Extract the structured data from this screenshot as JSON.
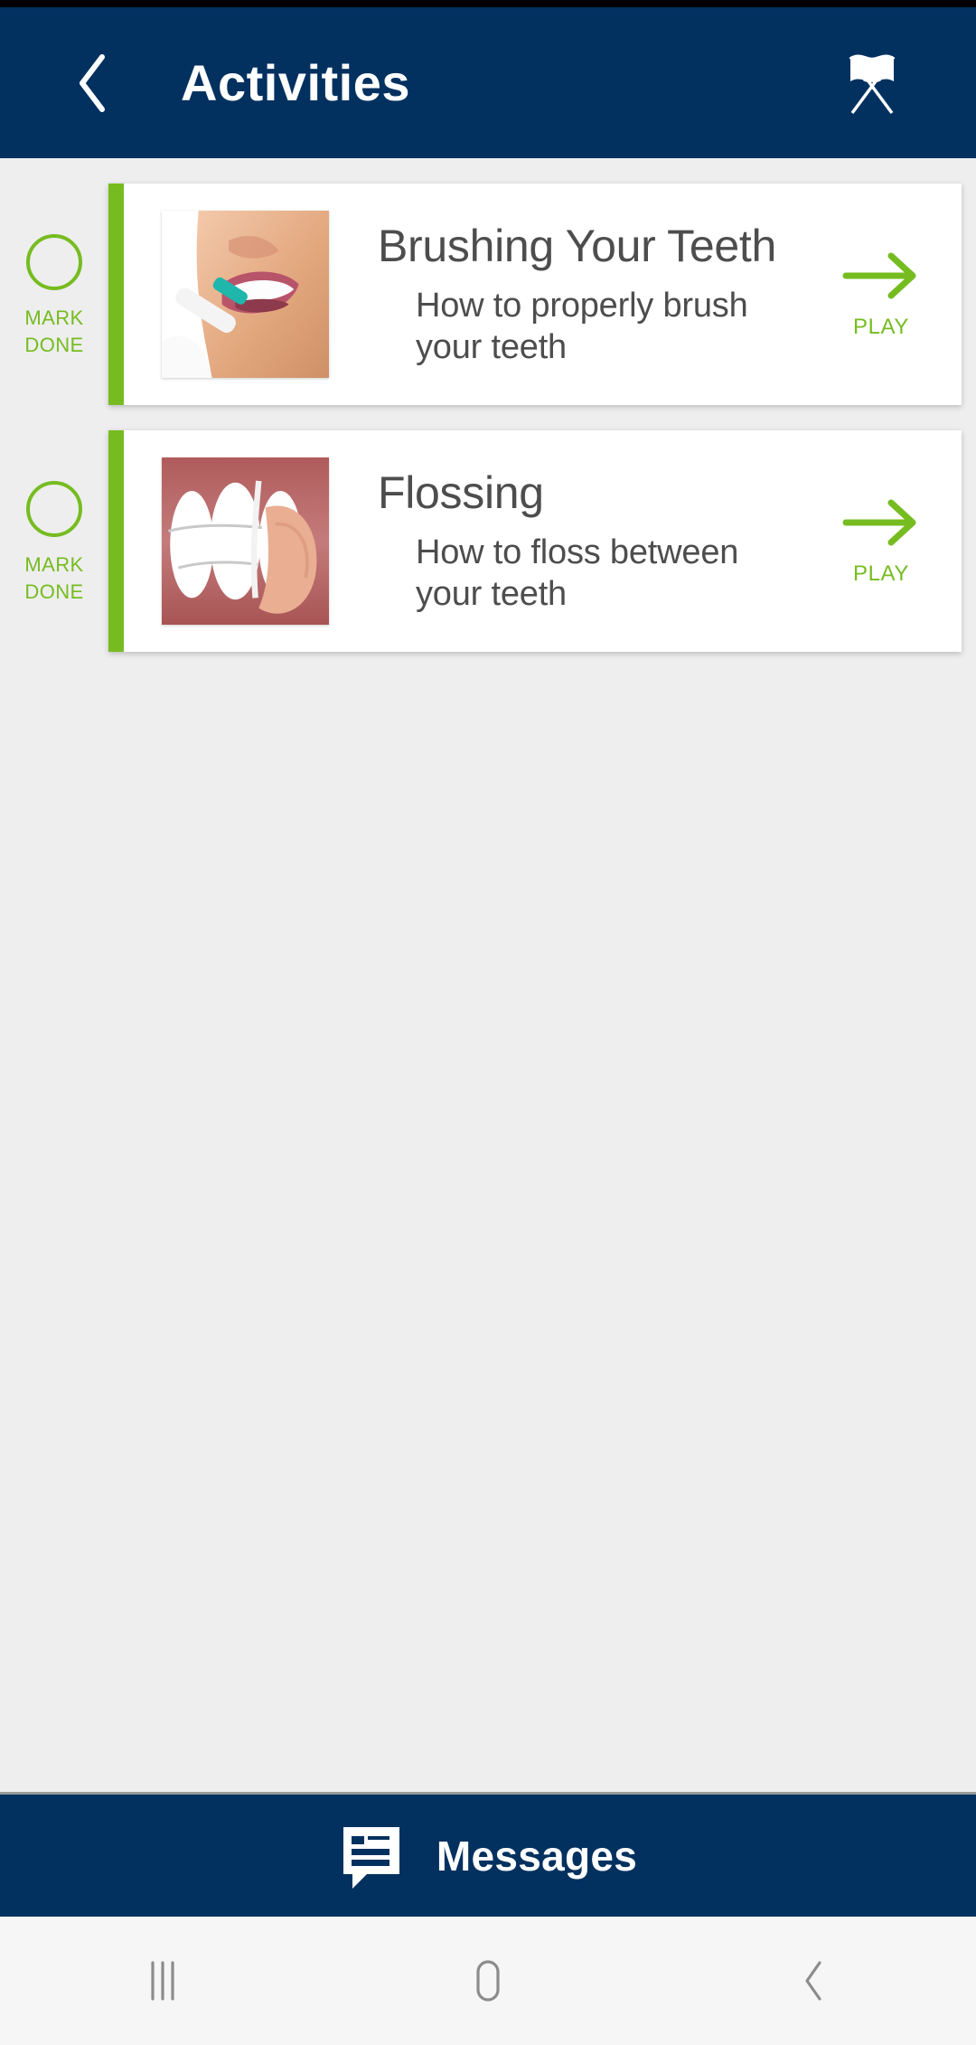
{
  "header": {
    "title": "Activities",
    "back_icon": "chevron-left-icon",
    "flags_icon": "crossed-flags-icon",
    "background_color": "#023160"
  },
  "theme": {
    "navy": "#023160",
    "green": "#76bc21",
    "page_background": "#eeeeee",
    "card_background": "#ffffff",
    "text_gray": "#4d4d4d"
  },
  "activities": [
    {
      "mark_done_line1": "MARK",
      "mark_done_line2": "DONE",
      "title": "Brushing Your Teeth",
      "description": "How to properly brush your teeth",
      "play_label": "PLAY",
      "play_icon": "arrow-right-icon",
      "thumbnail": "woman-brushing-teeth-photo"
    },
    {
      "mark_done_line1": "MARK",
      "mark_done_line2": "DONE",
      "title": "Flossing",
      "description": "How to floss between your teeth",
      "play_label": "PLAY",
      "play_icon": "arrow-right-icon",
      "thumbnail": "flossing-teeth-illustration"
    }
  ],
  "bottom_bar": {
    "label": "Messages",
    "icon": "message-bubble-icon"
  },
  "system_nav": {
    "recents_icon": "recents-bars-icon",
    "home_icon": "home-square-icon",
    "back_icon": "back-chevron-icon"
  }
}
